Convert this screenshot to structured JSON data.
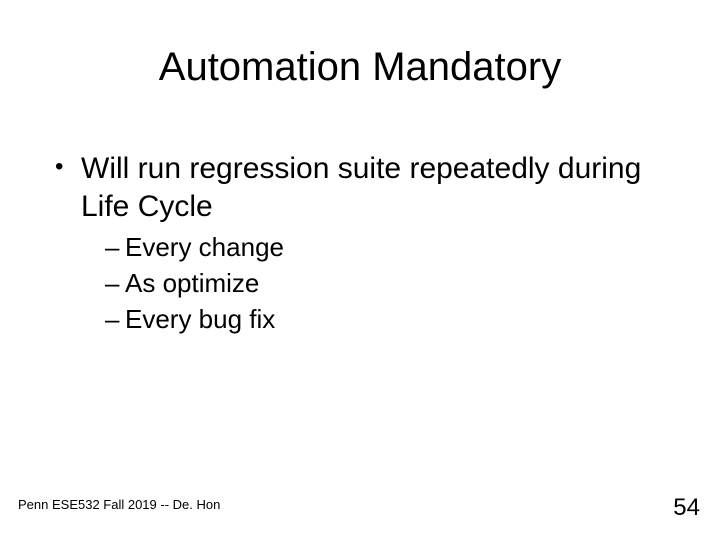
{
  "title": "Automation Mandatory",
  "bullets": {
    "level1_0": "Will run regression suite repeatedly during Life Cycle",
    "level2_0": "Every change",
    "level2_1": "As optimize",
    "level2_2": "Every bug fix"
  },
  "footer": {
    "left": "Penn ESE532 Fall 2019 -- De. Hon",
    "page": "54"
  }
}
